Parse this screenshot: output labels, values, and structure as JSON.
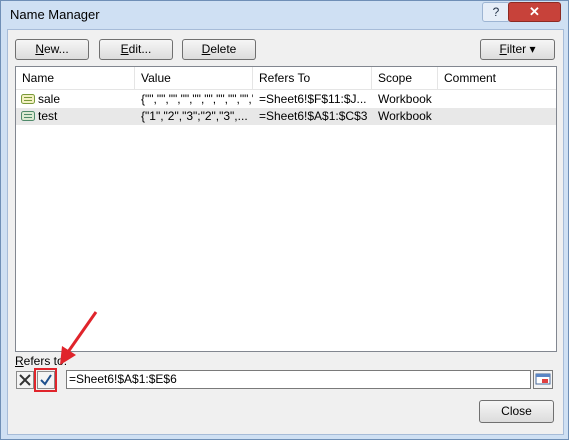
{
  "window": {
    "title": "Name Manager",
    "help_label": "?",
    "close_label": "✕"
  },
  "toolbar": {
    "new_prefix": "N",
    "new_rest": "ew...",
    "edit_prefix": "E",
    "edit_rest": "dit...",
    "delete_prefix": "D",
    "delete_rest": "elete",
    "filter_prefix": "F",
    "filter_rest": "ilter ▾"
  },
  "table": {
    "headers": [
      "Name",
      "Value",
      "Refers To",
      "Scope",
      "Comment"
    ],
    "rows": [
      {
        "name": "sale",
        "value": "{\"\",\"\",\"\",\"\",\"\",\"\",\"\",\"\",\"\",\"...",
        "refers_to": "=Sheet6!$F$11:$J...",
        "scope": "Workbook",
        "comment": ""
      },
      {
        "name": "test",
        "value": "{\"1\",\"2\",\"3\";\"2\",\"3\",...",
        "refers_to": "=Sheet6!$A$1:$C$3",
        "scope": "Workbook",
        "comment": ""
      }
    ]
  },
  "refers": {
    "label_prefix": "R",
    "label_rest": "efers to:",
    "value": "=Sheet6!$A$1:$E$6"
  },
  "footer": {
    "close_label": "Close"
  },
  "colors": {
    "title_bar": "#cfe0f3",
    "close_button": "#c7423a",
    "highlight": "#e0242b"
  }
}
